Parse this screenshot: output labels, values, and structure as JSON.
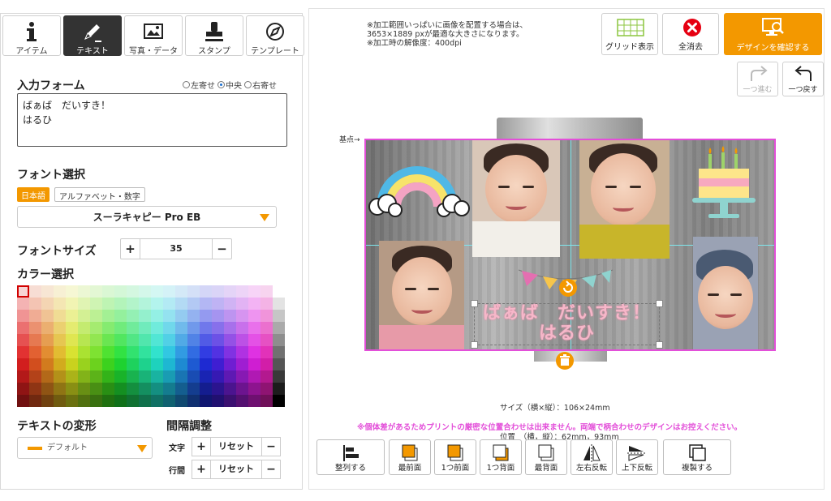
{
  "tabs": [
    {
      "label": "アイテム",
      "icon": "info-icon",
      "active": false
    },
    {
      "label": "テキスト",
      "icon": "pen-icon",
      "active": true
    },
    {
      "label": "写真・データ",
      "icon": "image-icon",
      "active": false
    },
    {
      "label": "スタンプ",
      "icon": "stamp-icon",
      "active": false
    },
    {
      "label": "テンプレート",
      "icon": "compass-icon",
      "active": false
    }
  ],
  "input_form": {
    "title": "入力フォーム",
    "align_left": "左寄せ",
    "align_center": "中央",
    "align_right": "右寄せ",
    "selected_align": "center",
    "text_value": "ばぁば　だいすき！\nはるひ"
  },
  "font_select": {
    "title": "フォント選択",
    "tab_japanese": "日本語",
    "tab_alpha": "アルファベット・数字",
    "selected_font": "スーラキャピー Pro EB"
  },
  "font_size": {
    "title": "フォントサイズ",
    "value": "35",
    "plus": "+",
    "minus": "−"
  },
  "color": {
    "title": "カラー選択",
    "accent": "#f39800"
  },
  "transform": {
    "title": "テキストの変形",
    "selected": "デフォルト"
  },
  "spacing": {
    "title": "間隔調整",
    "char_label": "文字",
    "line_label": "行間",
    "reset_label": "リセット",
    "plus": "+",
    "minus": "−"
  },
  "notice": {
    "line1": "※加工範囲いっぱいに画像を配置する場合は、",
    "line2": "3653×1889 pxが最適な大きさになります。",
    "line3": "※加工時の解像度：400dpi"
  },
  "toolbar": {
    "grid_label": "グリッド表示",
    "clear_label": "全消去",
    "confirm_label": "デザインを確認する",
    "redo_label": "一つ進む",
    "undo_label": "一つ戻す"
  },
  "canvas": {
    "base_label": "基点→",
    "text": "ばぁば　だいすき！\nはるひ",
    "border_color": "#e34fd9",
    "guide_color": "#7fe7ee"
  },
  "size_info": {
    "size": "サイズ（横×縦）：106×24mm",
    "position": "位置　（横，縦）：62mm，93mm"
  },
  "warning": "※個体差があるためプリントの厳密な位置合わせは出来ません。両端で柄合わせのデザインはお控えください。",
  "layer_buttons": [
    {
      "label": "整列する",
      "icon": "align-icon"
    },
    {
      "label": "最前面",
      "icon": "bring-front-icon"
    },
    {
      "label": "1つ前面",
      "icon": "bring-forward-icon"
    },
    {
      "label": "1つ背面",
      "icon": "send-backward-icon"
    },
    {
      "label": "最背面",
      "icon": "send-back-icon"
    },
    {
      "label": "左右反転",
      "icon": "flip-horizontal-icon"
    },
    {
      "label": "上下反転",
      "icon": "flip-vertical-icon"
    },
    {
      "label": "複製する",
      "icon": "duplicate-icon"
    }
  ]
}
